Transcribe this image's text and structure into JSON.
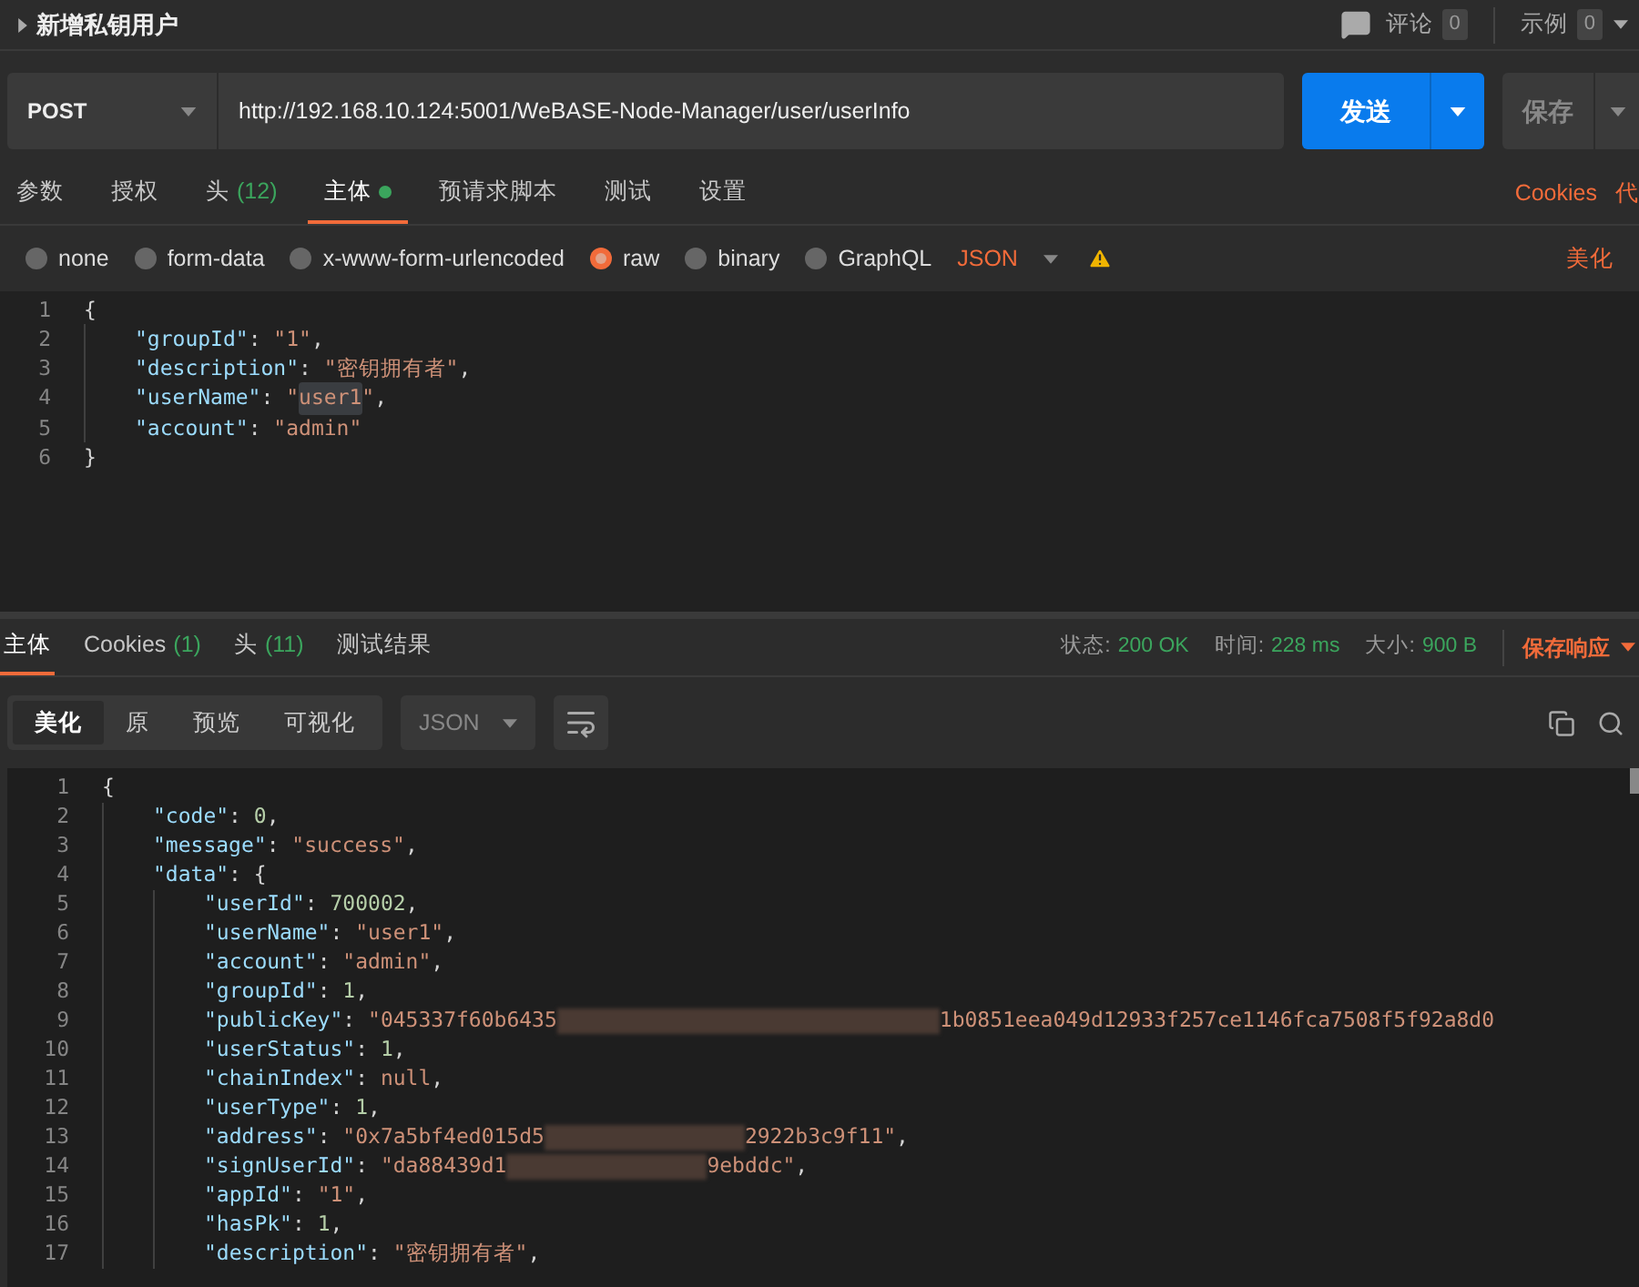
{
  "header": {
    "title": "新增私钥用户",
    "comments": {
      "label": "评论",
      "count": "0"
    },
    "examples": {
      "label": "示例",
      "count": "0"
    }
  },
  "request": {
    "method": "POST",
    "url": "http://192.168.10.124:5001/WeBASE-Node-Manager/user/userInfo",
    "send": "发送",
    "save": "保存"
  },
  "request_tabs": [
    {
      "label": "参数",
      "selected": false
    },
    {
      "label": "授权",
      "selected": false
    },
    {
      "label": "头",
      "count": "(12)",
      "selected": false
    },
    {
      "label": "主体",
      "has_content": true,
      "selected": true
    },
    {
      "label": "预请求脚本",
      "selected": false
    },
    {
      "label": "测试",
      "selected": false
    },
    {
      "label": "设置",
      "selected": false
    }
  ],
  "request_links": [
    "Cookies",
    "代"
  ],
  "body_types": [
    {
      "label": "none",
      "selected": false
    },
    {
      "label": "form-data",
      "selected": false
    },
    {
      "label": "x-www-form-urlencoded",
      "selected": false
    },
    {
      "label": "raw",
      "selected": true
    },
    {
      "label": "binary",
      "selected": false
    },
    {
      "label": "GraphQL",
      "selected": false
    }
  ],
  "body_format": "JSON",
  "beautify": "美化",
  "request_editor": {
    "lines": [
      {
        "n": "1",
        "tokens": [
          {
            "kind": "punct",
            "text": "{"
          }
        ],
        "children": [
          {
            "n": "2",
            "tokens": [
              {
                "kind": "key",
                "text": "\"groupId\""
              },
              {
                "kind": "punct",
                "text": ": "
              },
              {
                "kind": "str",
                "text": "\"1\""
              },
              {
                "kind": "punct",
                "text": ","
              }
            ]
          },
          {
            "n": "3",
            "tokens": [
              {
                "kind": "key",
                "text": "\"description\""
              },
              {
                "kind": "punct",
                "text": ": "
              },
              {
                "kind": "str",
                "text": "\"密钥拥有者\""
              },
              {
                "kind": "punct",
                "text": ","
              }
            ]
          },
          {
            "n": "4",
            "tokens": [
              {
                "kind": "key",
                "text": "\"userName\""
              },
              {
                "kind": "punct",
                "text": ": "
              },
              {
                "kind": "str",
                "text": "\""
              },
              {
                "kind": "str",
                "text": "user1",
                "highlighted": true
              },
              {
                "kind": "str",
                "text": "\""
              },
              {
                "kind": "punct",
                "text": ","
              }
            ]
          },
          {
            "n": "5",
            "tokens": [
              {
                "kind": "key",
                "text": "\"account\""
              },
              {
                "kind": "punct",
                "text": ": "
              },
              {
                "kind": "str",
                "text": "\"admin\""
              }
            ]
          }
        ]
      },
      {
        "n": "6",
        "tokens": [
          {
            "kind": "punct",
            "text": "}"
          }
        ]
      }
    ]
  },
  "response_tabs": [
    {
      "label": "主体",
      "selected": true
    },
    {
      "label": "Cookies",
      "count": "(1)",
      "selected": false
    },
    {
      "label": "头",
      "count": "(11)",
      "selected": false
    },
    {
      "label": "测试结果",
      "selected": false
    }
  ],
  "response_status": [
    {
      "label": "状态:",
      "value": "200 OK"
    },
    {
      "label": "时间:",
      "value": "228 ms"
    },
    {
      "label": "大小:",
      "value": "900 B"
    }
  ],
  "save_response": "保存响应",
  "view_modes": [
    {
      "label": "美化",
      "selected": true
    },
    {
      "label": "原",
      "selected": false
    },
    {
      "label": "预览",
      "selected": false
    },
    {
      "label": "可视化",
      "selected": false
    }
  ],
  "response_format": "JSON",
  "response_editor": {
    "lines": [
      {
        "n": "1",
        "tokens": [
          {
            "kind": "punct",
            "text": "{"
          }
        ],
        "children": [
          {
            "n": "2",
            "tokens": [
              {
                "kind": "key",
                "text": "\"code\""
              },
              {
                "kind": "punct",
                "text": ": "
              },
              {
                "kind": "num",
                "text": "0"
              },
              {
                "kind": "punct",
                "text": ","
              }
            ]
          },
          {
            "n": "3",
            "tokens": [
              {
                "kind": "key",
                "text": "\"message\""
              },
              {
                "kind": "punct",
                "text": ": "
              },
              {
                "kind": "str",
                "text": "\"success\""
              },
              {
                "kind": "punct",
                "text": ","
              }
            ]
          },
          {
            "n": "4",
            "tokens": [
              {
                "kind": "key",
                "text": "\"data\""
              },
              {
                "kind": "punct",
                "text": ": {"
              }
            ],
            "children": [
              {
                "n": "5",
                "tokens": [
                  {
                    "kind": "key",
                    "text": "\"userId\""
                  },
                  {
                    "kind": "punct",
                    "text": ": "
                  },
                  {
                    "kind": "num",
                    "text": "700002"
                  },
                  {
                    "kind": "punct",
                    "text": ","
                  }
                ]
              },
              {
                "n": "6",
                "tokens": [
                  {
                    "kind": "key",
                    "text": "\"userName\""
                  },
                  {
                    "kind": "punct",
                    "text": ": "
                  },
                  {
                    "kind": "str",
                    "text": "\"user1\""
                  },
                  {
                    "kind": "punct",
                    "text": ","
                  }
                ]
              },
              {
                "n": "7",
                "tokens": [
                  {
                    "kind": "key",
                    "text": "\"account\""
                  },
                  {
                    "kind": "punct",
                    "text": ": "
                  },
                  {
                    "kind": "str",
                    "text": "\"admin\""
                  },
                  {
                    "kind": "punct",
                    "text": ","
                  }
                ]
              },
              {
                "n": "8",
                "tokens": [
                  {
                    "kind": "key",
                    "text": "\"groupId\""
                  },
                  {
                    "kind": "punct",
                    "text": ": "
                  },
                  {
                    "kind": "num",
                    "text": "1"
                  },
                  {
                    "kind": "punct",
                    "text": ","
                  }
                ]
              },
              {
                "n": "9",
                "tokens": [
                  {
                    "kind": "key",
                    "text": "\"publicKey\""
                  },
                  {
                    "kind": "punct",
                    "text": ": "
                  },
                  {
                    "kind": "str",
                    "text": "\"045337f60b6435"
                  },
                  {
                    "kind": "redacted",
                    "wide": true
                  },
                  {
                    "kind": "str",
                    "text": "1b0851eea049d12933f257ce1146fca7508f5f92a8d0"
                  }
                ]
              },
              {
                "n": "10",
                "tokens": [
                  {
                    "kind": "key",
                    "text": "\"userStatus\""
                  },
                  {
                    "kind": "punct",
                    "text": ": "
                  },
                  {
                    "kind": "num",
                    "text": "1"
                  },
                  {
                    "kind": "punct",
                    "text": ","
                  }
                ]
              },
              {
                "n": "11",
                "tokens": [
                  {
                    "kind": "key",
                    "text": "\"chainIndex\""
                  },
                  {
                    "kind": "punct",
                    "text": ": "
                  },
                  {
                    "kind": "null",
                    "text": "null"
                  },
                  {
                    "kind": "punct",
                    "text": ","
                  }
                ]
              },
              {
                "n": "12",
                "tokens": [
                  {
                    "kind": "key",
                    "text": "\"userType\""
                  },
                  {
                    "kind": "punct",
                    "text": ": "
                  },
                  {
                    "kind": "num",
                    "text": "1"
                  },
                  {
                    "kind": "punct",
                    "text": ","
                  }
                ]
              },
              {
                "n": "13",
                "tokens": [
                  {
                    "kind": "key",
                    "text": "\"address\""
                  },
                  {
                    "kind": "punct",
                    "text": ": "
                  },
                  {
                    "kind": "str",
                    "text": "\"0x7a5bf4ed015d5"
                  },
                  {
                    "kind": "redacted",
                    "wide": false
                  },
                  {
                    "kind": "str",
                    "text": "2922b3c9f11\""
                  },
                  {
                    "kind": "punct",
                    "text": ","
                  }
                ]
              },
              {
                "n": "14",
                "tokens": [
                  {
                    "kind": "key",
                    "text": "\"signUserId\""
                  },
                  {
                    "kind": "punct",
                    "text": ": "
                  },
                  {
                    "kind": "str",
                    "text": "\"da88439d1"
                  },
                  {
                    "kind": "redacted",
                    "wide": false
                  },
                  {
                    "kind": "str",
                    "text": "9ebddc\""
                  },
                  {
                    "kind": "punct",
                    "text": ","
                  }
                ]
              },
              {
                "n": "15",
                "tokens": [
                  {
                    "kind": "key",
                    "text": "\"appId\""
                  },
                  {
                    "kind": "punct",
                    "text": ": "
                  },
                  {
                    "kind": "str",
                    "text": "\"1\""
                  },
                  {
                    "kind": "punct",
                    "text": ","
                  }
                ]
              },
              {
                "n": "16",
                "tokens": [
                  {
                    "kind": "key",
                    "text": "\"hasPk\""
                  },
                  {
                    "kind": "punct",
                    "text": ": "
                  },
                  {
                    "kind": "num",
                    "text": "1"
                  },
                  {
                    "kind": "punct",
                    "text": ","
                  }
                ]
              },
              {
                "n": "17",
                "tokens": [
                  {
                    "kind": "key",
                    "text": "\"description\""
                  },
                  {
                    "kind": "punct",
                    "text": ": "
                  },
                  {
                    "kind": "str",
                    "text": "\"密钥拥有者\""
                  },
                  {
                    "kind": "punct",
                    "text": ","
                  }
                ]
              }
            ]
          }
        ]
      }
    ]
  }
}
